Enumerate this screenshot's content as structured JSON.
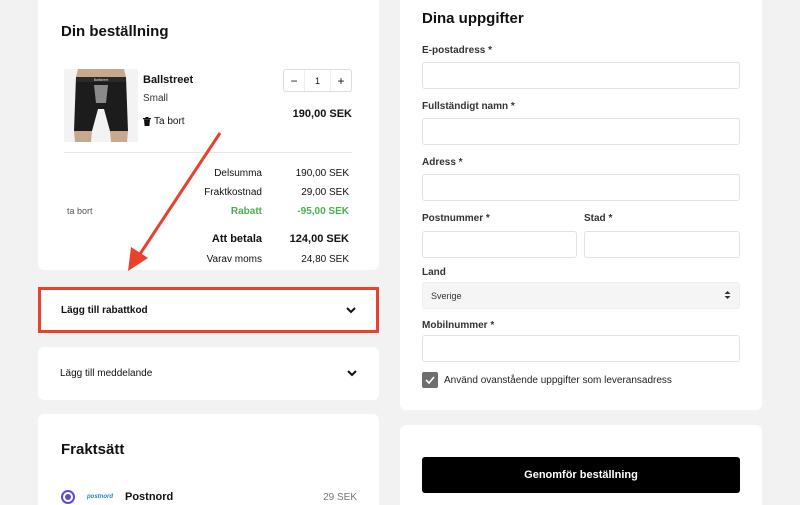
{
  "order": {
    "title": "Din beställning",
    "product": {
      "name": "Ballstreet",
      "variant": "Small",
      "remove_label": "Ta bort",
      "quantity": "1",
      "price": "190,00 SEK",
      "image_brand": "Ballstreet"
    },
    "qty_minus": "−",
    "qty_plus": "+",
    "summary": {
      "subtotal_label": "Delsumma",
      "subtotal_value": "190,00 SEK",
      "shipping_label": "Fraktkostnad",
      "shipping_value": "29,00 SEK",
      "discount_remove": "ta bort",
      "discount_label": "Rabatt",
      "discount_value": "-95,00 SEK",
      "total_label": "Att betala",
      "total_value": "124,00 SEK",
      "vat_label": "Varav moms",
      "vat_value": "24,80 SEK"
    }
  },
  "coupon": {
    "label": "Lägg till rabattkod"
  },
  "message": {
    "label": "Lägg till meddelande"
  },
  "shipping": {
    "title": "Fraktsätt",
    "option": {
      "logo_text": "postnord",
      "name": "Postnord",
      "price": "29 SEK"
    }
  },
  "details": {
    "title": "Dina uppgifter",
    "email_label": "E-postadress *",
    "name_label": "Fullständigt namn *",
    "address_label": "Adress *",
    "postcode_label": "Postnummer *",
    "city_label": "Stad *",
    "country_label": "Land",
    "country_value": "Sverige",
    "phone_label": "Mobilnummer *",
    "same_address_label": "Använd ovanstående uppgifter som leveransadress"
  },
  "checkout": {
    "button_label": "Genomför beställning"
  },
  "colors": {
    "accent_red": "#e8422f",
    "discount_green": "#4caf50",
    "radio_purple": "#5c4bd6"
  }
}
